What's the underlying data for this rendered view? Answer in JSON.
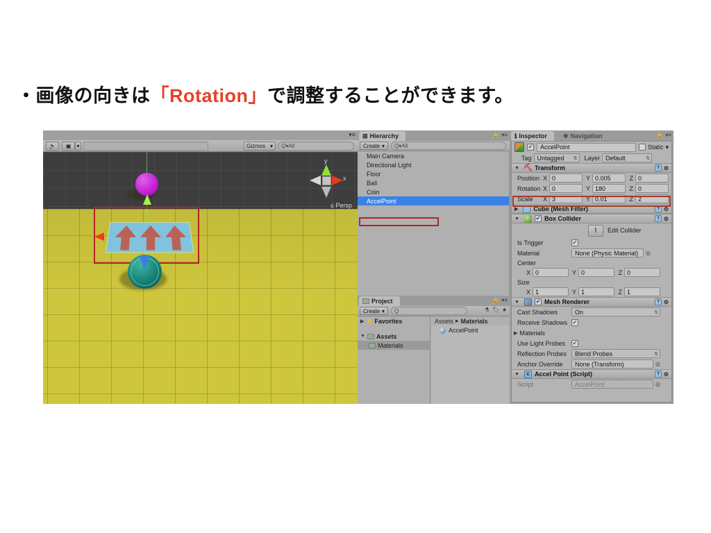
{
  "slide": {
    "bullet": "・",
    "text_before": "画像の向きは",
    "accent_text": "「Rotation」",
    "text_after": "で調整することができます。",
    "accent_color": "#e8402a"
  },
  "scene_view": {
    "toolbar": {
      "audio_icon": "speaker-icon",
      "lighting_icon": "image-icon",
      "lighting_dropdown_arrow": "▾",
      "gizmos_label": "Gizmos",
      "gizmos_arrow": "▾",
      "search_placeholder": "Q▾All"
    },
    "gizmo": {
      "y_label": "y",
      "x_label": "x",
      "projection_label": "≤ Persp"
    },
    "objects": {
      "floor_color": "#cec63d",
      "ball_color": "#c013cf",
      "coin_color": "#13786d",
      "accel_panel_color": "#78c3f5",
      "arrow_color": "#bb6257",
      "selection_outline_color": "#b42424"
    }
  },
  "hierarchy": {
    "tab_label": "Hierarchy",
    "tab_icon": "hierarchy-icon",
    "lock_icon": "lock-icon",
    "menu_icon": "▾≡",
    "create_label": "Create",
    "create_arrow": "▾",
    "search_placeholder": "Q▾All",
    "items": [
      {
        "label": "Main Camera",
        "selected": false
      },
      {
        "label": "Directional Light",
        "selected": false
      },
      {
        "label": "Floor",
        "selected": false
      },
      {
        "label": "Ball",
        "selected": false
      },
      {
        "label": "Coin",
        "selected": false
      },
      {
        "label": "AccelPoint",
        "selected": true
      }
    ]
  },
  "project": {
    "tab_label": "Project",
    "tab_icon": "folder-icon",
    "lock_icon": "lock-icon",
    "menu_icon": "▾≡",
    "create_label": "Create",
    "create_arrow": "▾",
    "search_placeholder": "Q",
    "toolbar_icons": [
      "filter-icon",
      "label-icon",
      "favorite-star-icon"
    ],
    "tree": [
      {
        "label": "Favorites",
        "icon": "star-icon",
        "expanded": false,
        "selected": false
      },
      {
        "label": "Assets",
        "icon": "folder-icon",
        "expanded": true,
        "selected": false
      },
      {
        "label": "Materials",
        "icon": "folder-icon",
        "expanded": false,
        "selected": true
      }
    ],
    "breadcrumb": {
      "root": "Assets",
      "separator": "▸",
      "current": "Materials"
    },
    "assets": [
      {
        "label": "AccelPoint",
        "icon": "material-sphere-icon"
      }
    ]
  },
  "inspector": {
    "tabs": [
      {
        "label": "Inspector",
        "icon": "info-icon",
        "active": true
      },
      {
        "label": "Navigation",
        "icon": "navigation-icon",
        "active": false
      }
    ],
    "lock_icon": "lock-icon",
    "menu_icon": "▾≡",
    "object_header": {
      "icon": "cube-icon",
      "enabled": true,
      "name": "AccelPoint",
      "static_label": "Static",
      "static_checked": false,
      "static_arrow": "▾"
    },
    "tag_layer": {
      "tag_label": "Tag",
      "tag_value": "Untagged",
      "layer_label": "Layer",
      "layer_value": "Default"
    },
    "components": [
      {
        "name": "Transform",
        "icon": "transform-icon",
        "expanded": true,
        "rows": [
          {
            "label": "Position",
            "x": "0",
            "y": "0.005",
            "z": "0",
            "highlighted": false
          },
          {
            "label": "Rotation",
            "x": "0",
            "y": "180",
            "z": "0",
            "highlighted": true
          },
          {
            "label": "Scale",
            "x": "3",
            "y": "0.01",
            "z": "2",
            "highlighted": false
          }
        ]
      },
      {
        "name": "Cube (Mesh Filter)",
        "icon": "mesh-icon",
        "expanded": false
      },
      {
        "name": "Box Collider",
        "icon": "collider-icon",
        "expanded": true,
        "enabled": true,
        "edit_collider_label": "Edit Collider",
        "edit_collider_icon": "collider-edit-icon",
        "is_trigger_label": "Is Trigger",
        "is_trigger_checked": true,
        "material_label": "Material",
        "material_value": "None (Physic Material)",
        "center_label": "Center",
        "center": {
          "x": "0",
          "y": "0",
          "z": "0"
        },
        "size_label": "Size",
        "size": {
          "x": "1",
          "y": "1",
          "z": "1"
        }
      },
      {
        "name": "Mesh Renderer",
        "icon": "renderer-icon",
        "expanded": true,
        "enabled": true,
        "properties": [
          {
            "label": "Cast Shadows",
            "type": "popup",
            "value": "On"
          },
          {
            "label": "Receive Shadows",
            "type": "checkbox",
            "value": true
          },
          {
            "label": "Materials",
            "type": "foldout",
            "value": ""
          },
          {
            "label": "Use Light Probes",
            "type": "checkbox",
            "value": true
          },
          {
            "label": "Reflection Probes",
            "type": "popup",
            "value": "Blend Probes"
          },
          {
            "label": "Anchor Override",
            "type": "object",
            "value": "None (Transform)"
          }
        ]
      },
      {
        "name": "Accel Point (Script)",
        "icon": "script-icon",
        "expanded": true,
        "script_label": "Script",
        "script_value": "AccelPoint"
      }
    ],
    "highlight_color": "#a33a27"
  }
}
